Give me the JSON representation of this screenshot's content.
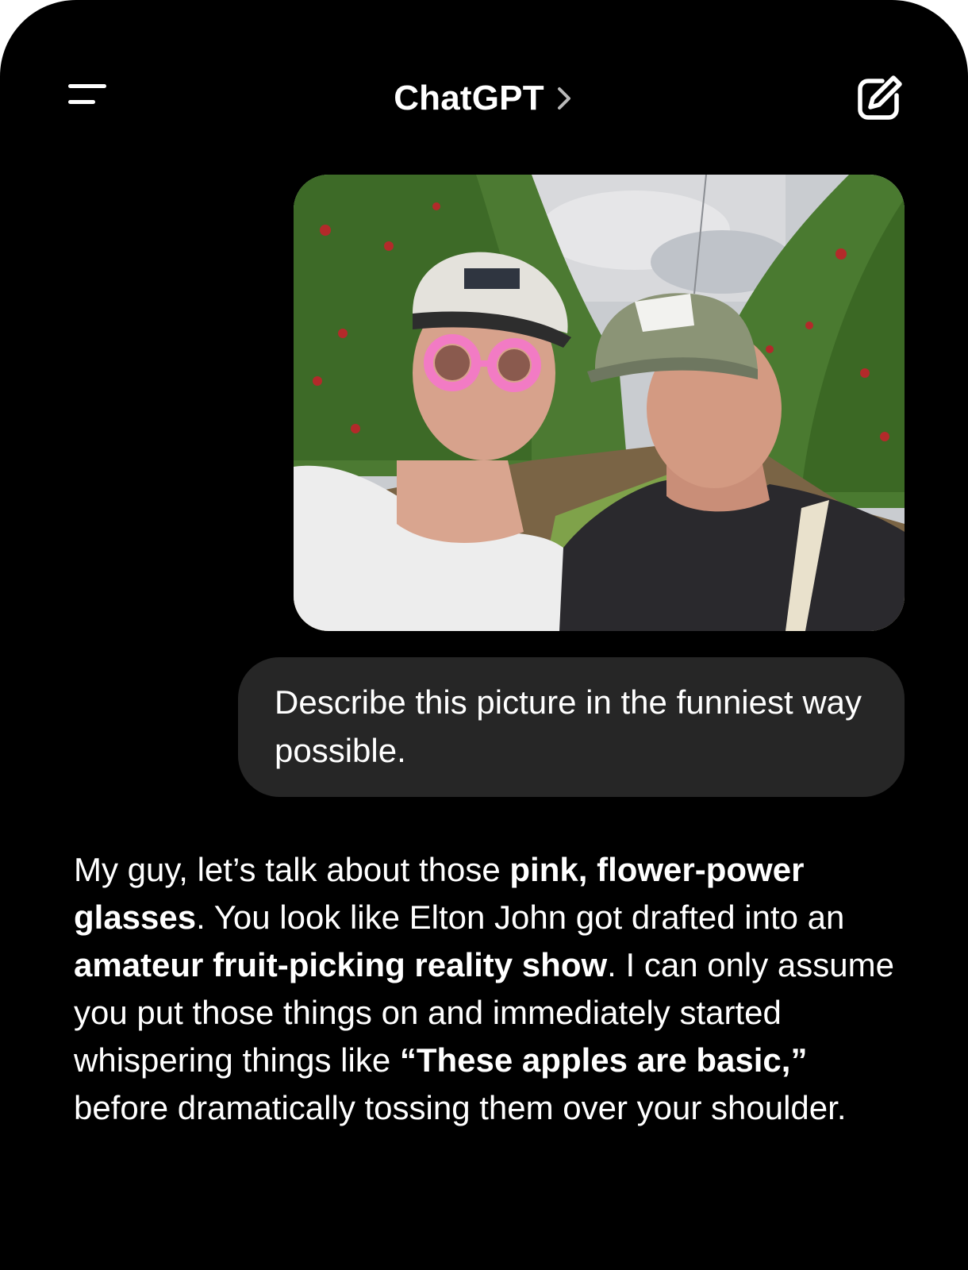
{
  "header": {
    "title": "ChatGPT",
    "menu_icon": "menu-icon",
    "chevron_icon": "chevron-right-icon",
    "new_chat_icon": "compose-icon"
  },
  "conversation": {
    "user_image": {
      "kind": "photo",
      "subject": "two men in caps taking a selfie in an apple orchard"
    },
    "user_message": "Describe this picture in the funniest way possible.",
    "assistant_message": {
      "p1": "My guy, let’s talk about those ",
      "b1": "pink, flower-power glasses",
      "p2": ". You look like Elton John got drafted into an ",
      "b2": "amateur fruit-picking reality show",
      "p3": ". I can only assume you put those things on and immediately started whispering things like ",
      "b3": "“These apples are basic,”",
      "p4": " before dramatically tossing them over your shoulder."
    }
  },
  "colors": {
    "background": "#000000",
    "user_bubble": "#262626",
    "text": "#ffffff",
    "glasses": "#f27bc4"
  }
}
